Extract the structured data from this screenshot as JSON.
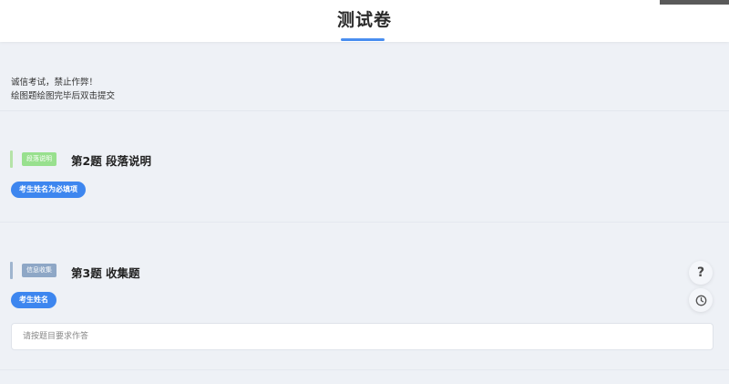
{
  "header": {
    "title": "测试卷"
  },
  "notice": {
    "line1": "诚信考试，禁止作弊！",
    "line2": "绘图题绘图完毕后双击提交"
  },
  "questions": [
    {
      "tag": "段落说明",
      "title": "第2题 段落说明",
      "pill": "考生姓名为必填项"
    },
    {
      "tag": "信息收集",
      "title": "第3题 收集题",
      "pill": "考生姓名",
      "answer_placeholder": "请按题目要求作答"
    }
  ],
  "floating": {
    "help_glyph": "?",
    "icons": [
      "question-icon",
      "clock-icon"
    ]
  },
  "colors": {
    "accent": "#3d86ef",
    "underline": "#4a8ef0",
    "tag_paragraph": "#98e08e",
    "tag_collect": "#8ea7c6",
    "background": "#eef1f6"
  }
}
